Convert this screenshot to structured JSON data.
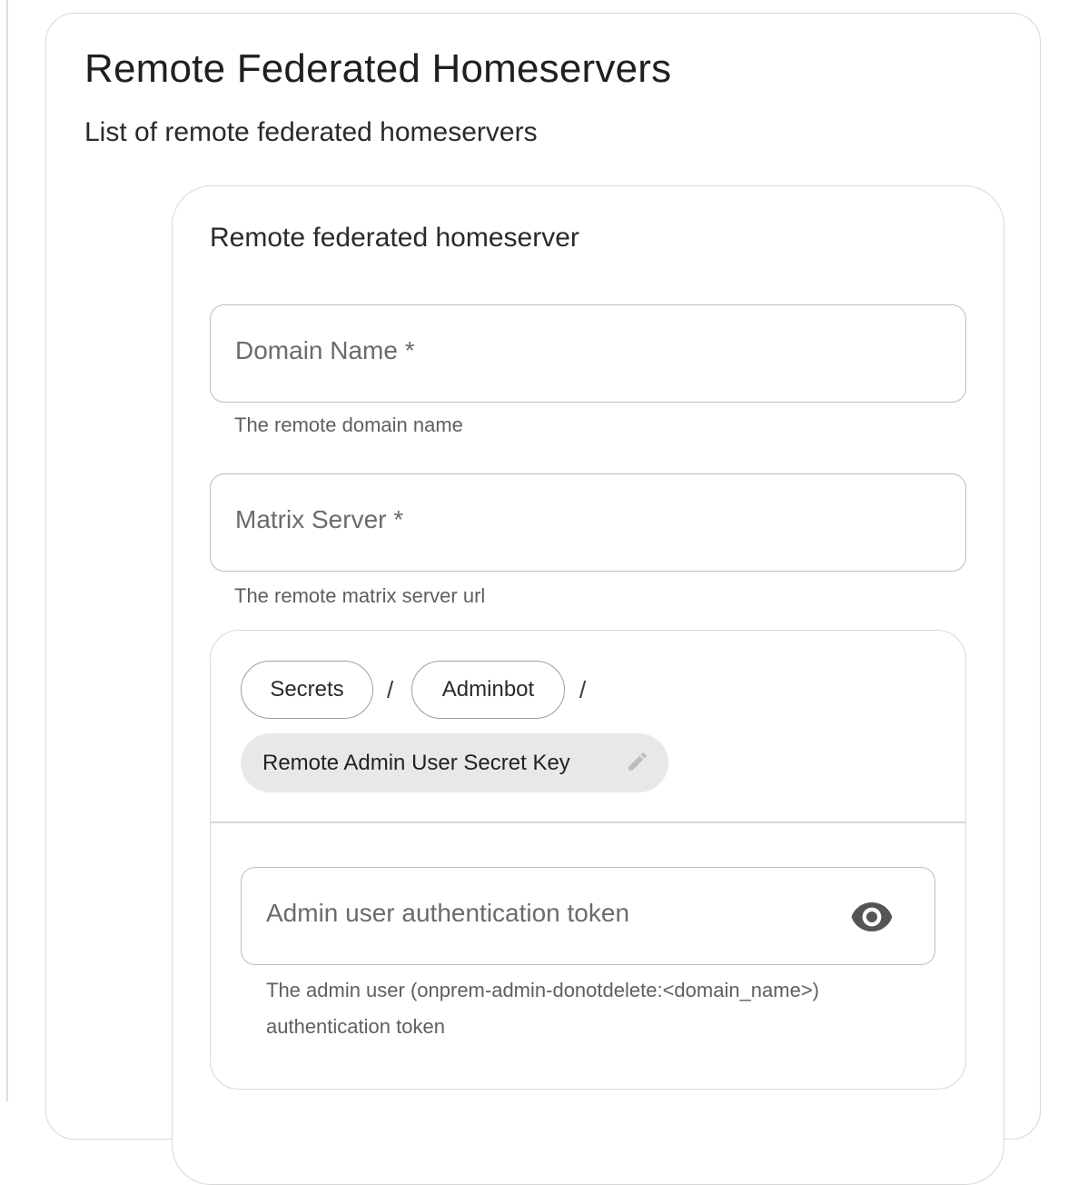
{
  "section": {
    "title": "Remote Federated Homeservers",
    "subtitle": "List of remote federated homeservers"
  },
  "homeserver": {
    "title": "Remote federated homeserver",
    "domain_field": {
      "label": "Domain Name *",
      "value": "",
      "helper": "The remote domain name"
    },
    "matrix_field": {
      "label": "Matrix Server *",
      "value": "",
      "helper": "The remote matrix server url"
    },
    "secret": {
      "breadcrumb": [
        "Secrets",
        "Adminbot"
      ],
      "separator": "/",
      "key_label": "Remote Admin User Secret Key",
      "token_field": {
        "label": "Admin user authentication token",
        "value": "",
        "helper": "The admin user (onprem-admin-donotdelete:<domain_name>) authentication token"
      }
    }
  },
  "colors": {
    "border": "#d7d7d7",
    "field_border": "#bdbdbd",
    "chip_bg": "#e8e8e8",
    "text": "#1f1f1f",
    "muted": "#5f5f5f"
  },
  "icons": [
    "pencil-icon",
    "eye-icon"
  ]
}
